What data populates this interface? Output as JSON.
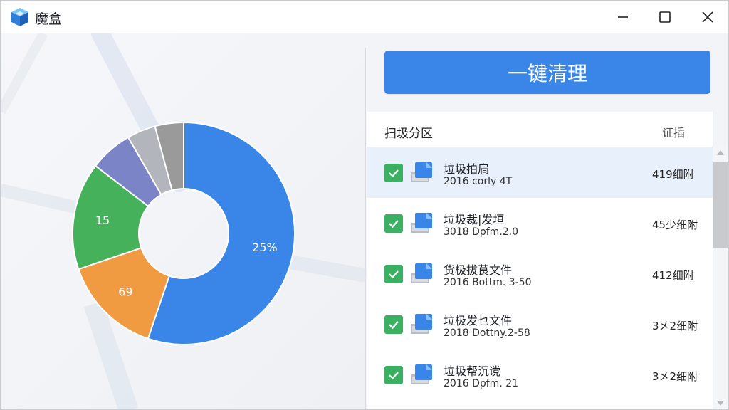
{
  "app": {
    "title": "魔盒",
    "accent_color": "#3a86e8"
  },
  "window_controls": [
    "minimize-icon",
    "maximize-icon",
    "close-icon"
  ],
  "actions": {
    "clean_label": "一键清理"
  },
  "list": {
    "header_left": "扫圾分区",
    "header_right": "证插",
    "items": [
      {
        "name": "垃圾拍扃",
        "detail": "2016 corly 4T",
        "size": "419细附",
        "checked": true,
        "selected": true
      },
      {
        "name": "垃圾裁|发垣",
        "detail": "3018 Dpfm.2.0",
        "size": "45少细附",
        "checked": true,
        "selected": false
      },
      {
        "name": "货极拔茛文件",
        "detail": "2016 Bottm. 3-50",
        "size": "412细附",
        "checked": true,
        "selected": false
      },
      {
        "name": "垃极发乜文件",
        "detail": "2018 Dottny.2-58",
        "size": "3㐅2细附",
        "checked": true,
        "selected": false
      },
      {
        "name": "垃圾帮沉谠",
        "detail": "2016 Dpfm. 21",
        "size": "3㐅2细附",
        "checked": true,
        "selected": false
      }
    ]
  },
  "chart_data": {
    "type": "pie",
    "categories": [
      "blue",
      "orange",
      "green",
      "purple",
      "light-gray",
      "dark-gray"
    ],
    "values": [
      53,
      14,
      15,
      6,
      4,
      4
    ],
    "slice_labels": [
      "25%",
      "69",
      "15",
      "",
      "",
      ""
    ],
    "colors": [
      "#3a86e8",
      "#f09a42",
      "#45b15a",
      "#7b84c7",
      "#b2b5bb",
      "#9a9a9a"
    ],
    "donut": true
  }
}
